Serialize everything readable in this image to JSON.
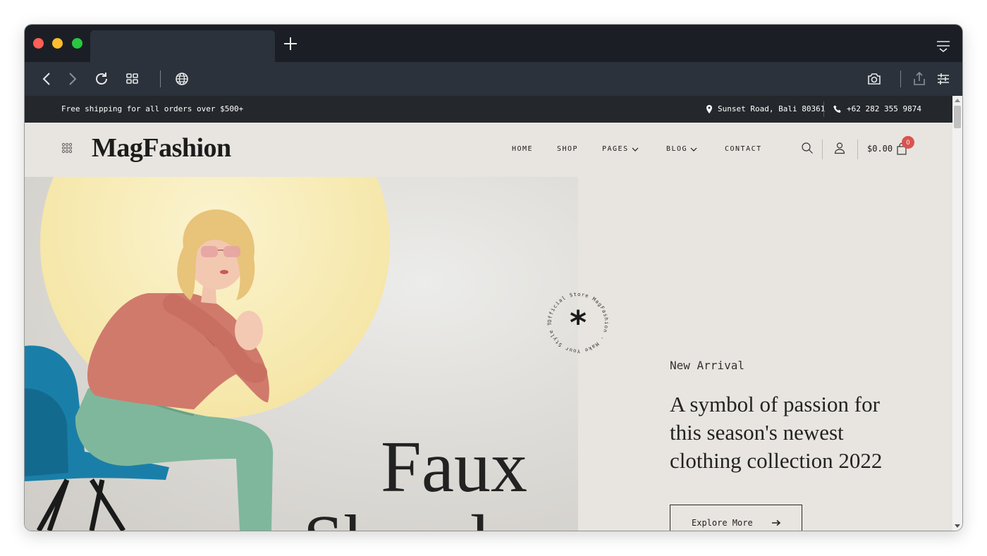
{
  "browser": {
    "icons": [
      "close-window",
      "minimize-window",
      "maximize-window",
      "new-tab-icon",
      "tab-menu-icon",
      "back-icon",
      "forward-icon",
      "reload-icon",
      "tab-overview-icon",
      "globe-icon",
      "camera-icon",
      "share-icon",
      "settings-sliders-icon"
    ]
  },
  "topbar": {
    "shipping": "Free shipping for all orders over $500+",
    "address": "Sunset Road, Bali 80361",
    "phone": "+62 282 355 9874"
  },
  "header": {
    "logo": "MagFashion",
    "nav": [
      {
        "label": "HOME"
      },
      {
        "label": "SHOP"
      },
      {
        "label": "PAGES"
      },
      {
        "label": "BLOG"
      },
      {
        "label": "CONTACT"
      }
    ],
    "cart_total": "$0.00",
    "cart_count": "0"
  },
  "hero": {
    "badge_text": "Official Store MagFashion · Make Your Style Trendy ·",
    "badge_symbol": "*",
    "big_title_line1": "Faux",
    "big_title_line2": "Shearl",
    "eyebrow": "New Arrival",
    "headline": "A symbol of passion for this season's newest clothing collection 2022",
    "cta": "Explore More"
  },
  "colors": {
    "page_bg": "#e8e5e0",
    "dark_bar": "#24272b",
    "badge_red": "#d9534f",
    "browser_dark": "#1b1f25",
    "browser_toolbar": "#2b323b"
  }
}
